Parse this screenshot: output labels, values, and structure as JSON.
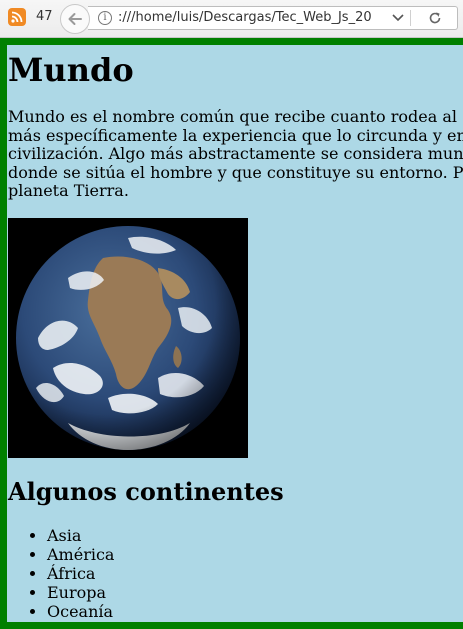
{
  "browser": {
    "tab_count": "47",
    "url": ":///home/luis/Descargas/Tec_Web_Js_20",
    "info_symbol": "i"
  },
  "page": {
    "title": "Mundo",
    "intro_lines": [
      "Mundo es el nombre común que recibe cuanto rodea al s",
      "más específicamente la experiencia que lo circunda y en",
      "civilización. Algo más abstractamente se considera mund",
      "donde se sitúa el hombre y que constituye su entorno. Po",
      "planeta Tierra."
    ],
    "image_name": "earth-photo",
    "continents_heading": "Algunos continentes",
    "continents": [
      "Asia",
      "América",
      "África",
      "Europa",
      "Oceanía"
    ]
  },
  "colors": {
    "page_background": "#add8e6",
    "page_border": "#008000",
    "feed_icon": "#f08a24"
  }
}
